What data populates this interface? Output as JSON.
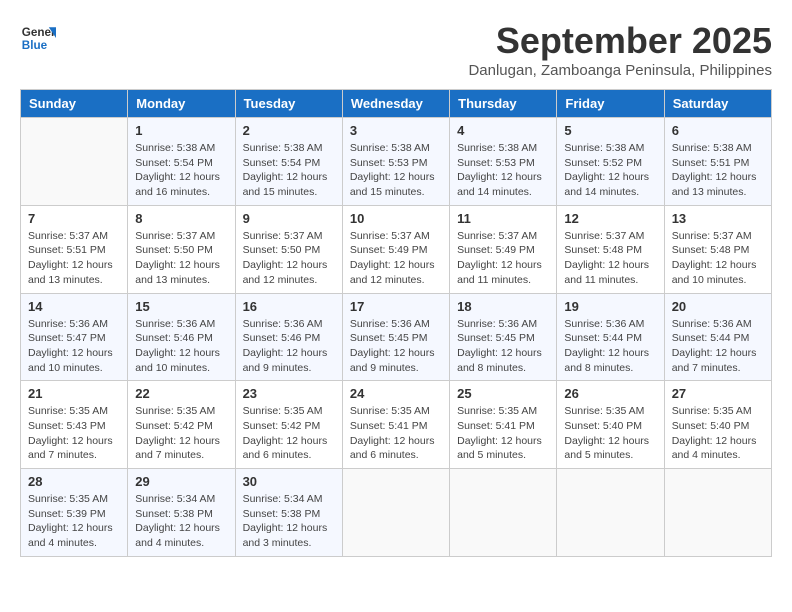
{
  "header": {
    "logo_line1": "General",
    "logo_line2": "Blue",
    "month": "September 2025",
    "location": "Danlugan, Zamboanga Peninsula, Philippines"
  },
  "days_of_week": [
    "Sunday",
    "Monday",
    "Tuesday",
    "Wednesday",
    "Thursday",
    "Friday",
    "Saturday"
  ],
  "weeks": [
    [
      {
        "day": "",
        "content": ""
      },
      {
        "day": "1",
        "content": "Sunrise: 5:38 AM\nSunset: 5:54 PM\nDaylight: 12 hours\nand 16 minutes."
      },
      {
        "day": "2",
        "content": "Sunrise: 5:38 AM\nSunset: 5:54 PM\nDaylight: 12 hours\nand 15 minutes."
      },
      {
        "day": "3",
        "content": "Sunrise: 5:38 AM\nSunset: 5:53 PM\nDaylight: 12 hours\nand 15 minutes."
      },
      {
        "day": "4",
        "content": "Sunrise: 5:38 AM\nSunset: 5:53 PM\nDaylight: 12 hours\nand 14 minutes."
      },
      {
        "day": "5",
        "content": "Sunrise: 5:38 AM\nSunset: 5:52 PM\nDaylight: 12 hours\nand 14 minutes."
      },
      {
        "day": "6",
        "content": "Sunrise: 5:38 AM\nSunset: 5:51 PM\nDaylight: 12 hours\nand 13 minutes."
      }
    ],
    [
      {
        "day": "7",
        "content": "Sunrise: 5:37 AM\nSunset: 5:51 PM\nDaylight: 12 hours\nand 13 minutes."
      },
      {
        "day": "8",
        "content": "Sunrise: 5:37 AM\nSunset: 5:50 PM\nDaylight: 12 hours\nand 13 minutes."
      },
      {
        "day": "9",
        "content": "Sunrise: 5:37 AM\nSunset: 5:50 PM\nDaylight: 12 hours\nand 12 minutes."
      },
      {
        "day": "10",
        "content": "Sunrise: 5:37 AM\nSunset: 5:49 PM\nDaylight: 12 hours\nand 12 minutes."
      },
      {
        "day": "11",
        "content": "Sunrise: 5:37 AM\nSunset: 5:49 PM\nDaylight: 12 hours\nand 11 minutes."
      },
      {
        "day": "12",
        "content": "Sunrise: 5:37 AM\nSunset: 5:48 PM\nDaylight: 12 hours\nand 11 minutes."
      },
      {
        "day": "13",
        "content": "Sunrise: 5:37 AM\nSunset: 5:48 PM\nDaylight: 12 hours\nand 10 minutes."
      }
    ],
    [
      {
        "day": "14",
        "content": "Sunrise: 5:36 AM\nSunset: 5:47 PM\nDaylight: 12 hours\nand 10 minutes."
      },
      {
        "day": "15",
        "content": "Sunrise: 5:36 AM\nSunset: 5:46 PM\nDaylight: 12 hours\nand 10 minutes."
      },
      {
        "day": "16",
        "content": "Sunrise: 5:36 AM\nSunset: 5:46 PM\nDaylight: 12 hours\nand 9 minutes."
      },
      {
        "day": "17",
        "content": "Sunrise: 5:36 AM\nSunset: 5:45 PM\nDaylight: 12 hours\nand 9 minutes."
      },
      {
        "day": "18",
        "content": "Sunrise: 5:36 AM\nSunset: 5:45 PM\nDaylight: 12 hours\nand 8 minutes."
      },
      {
        "day": "19",
        "content": "Sunrise: 5:36 AM\nSunset: 5:44 PM\nDaylight: 12 hours\nand 8 minutes."
      },
      {
        "day": "20",
        "content": "Sunrise: 5:36 AM\nSunset: 5:44 PM\nDaylight: 12 hours\nand 7 minutes."
      }
    ],
    [
      {
        "day": "21",
        "content": "Sunrise: 5:35 AM\nSunset: 5:43 PM\nDaylight: 12 hours\nand 7 minutes."
      },
      {
        "day": "22",
        "content": "Sunrise: 5:35 AM\nSunset: 5:42 PM\nDaylight: 12 hours\nand 7 minutes."
      },
      {
        "day": "23",
        "content": "Sunrise: 5:35 AM\nSunset: 5:42 PM\nDaylight: 12 hours\nand 6 minutes."
      },
      {
        "day": "24",
        "content": "Sunrise: 5:35 AM\nSunset: 5:41 PM\nDaylight: 12 hours\nand 6 minutes."
      },
      {
        "day": "25",
        "content": "Sunrise: 5:35 AM\nSunset: 5:41 PM\nDaylight: 12 hours\nand 5 minutes."
      },
      {
        "day": "26",
        "content": "Sunrise: 5:35 AM\nSunset: 5:40 PM\nDaylight: 12 hours\nand 5 minutes."
      },
      {
        "day": "27",
        "content": "Sunrise: 5:35 AM\nSunset: 5:40 PM\nDaylight: 12 hours\nand 4 minutes."
      }
    ],
    [
      {
        "day": "28",
        "content": "Sunrise: 5:35 AM\nSunset: 5:39 PM\nDaylight: 12 hours\nand 4 minutes."
      },
      {
        "day": "29",
        "content": "Sunrise: 5:34 AM\nSunset: 5:38 PM\nDaylight: 12 hours\nand 4 minutes."
      },
      {
        "day": "30",
        "content": "Sunrise: 5:34 AM\nSunset: 5:38 PM\nDaylight: 12 hours\nand 3 minutes."
      },
      {
        "day": "",
        "content": ""
      },
      {
        "day": "",
        "content": ""
      },
      {
        "day": "",
        "content": ""
      },
      {
        "day": "",
        "content": ""
      }
    ]
  ]
}
